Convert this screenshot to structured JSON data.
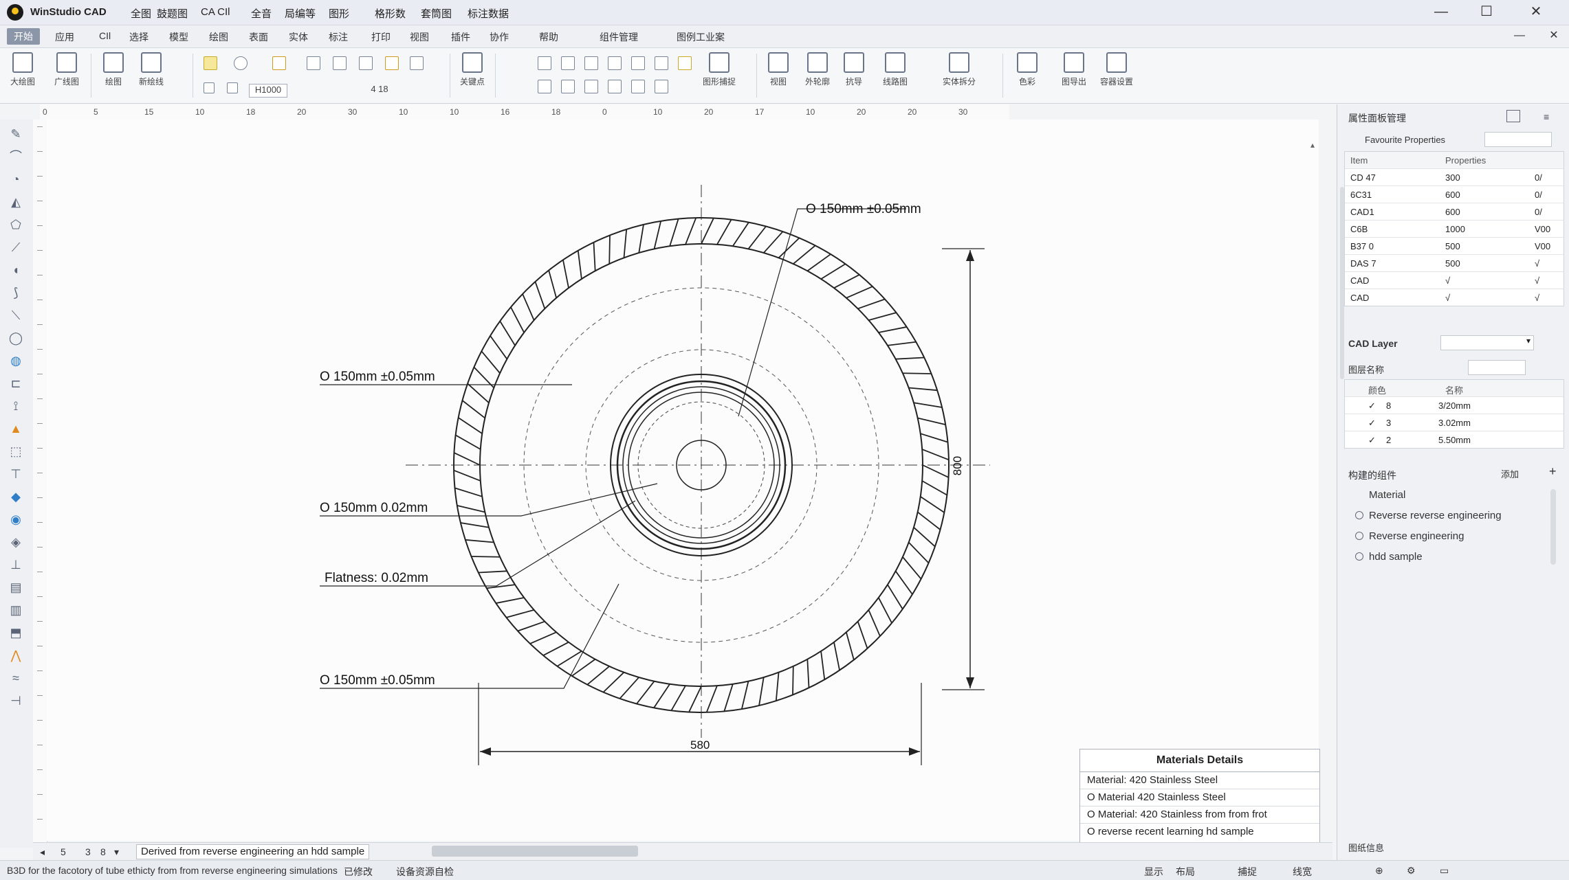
{
  "app": {
    "name": "WinStudio CAD",
    "menus": [
      "全图",
      "鼓题图",
      "CA CIl",
      "全音",
      "局编等",
      "图形",
      "格形数",
      "套筒图",
      "标注数据"
    ],
    "window_controls": [
      "—",
      "☐",
      "✕"
    ]
  },
  "tabs": [
    "开始",
    "应用",
    "CIl",
    "选择",
    "模型",
    "绘图",
    "表面",
    "实体",
    "标注",
    "打印",
    "视图",
    "插件",
    "协作",
    "帮助",
    "组件管理",
    "图例工业案"
  ],
  "ribbon": {
    "groups": [
      {
        "label": "大绘图"
      },
      {
        "label": "广线图"
      },
      {
        "label": "绘图"
      },
      {
        "label": "新绘线"
      },
      {
        "label": "H1000"
      },
      {
        "label": "4 18"
      },
      {
        "label": "关键点"
      },
      {
        "label": "图形捕捉"
      },
      {
        "label": "视图"
      },
      {
        "label": "外轮廓"
      },
      {
        "label": "抗导"
      },
      {
        "label": "线路图"
      },
      {
        "label": "实体拆分"
      },
      {
        "label": "色彩"
      },
      {
        "label": "图导出"
      },
      {
        "label": "容器设置"
      }
    ]
  },
  "ruler": {
    "ticks": [
      "0",
      "5",
      "15",
      "10",
      "18",
      "20",
      "30",
      "10",
      "10",
      "16",
      "18",
      "0",
      "10",
      "20",
      "17",
      "10",
      "20",
      "20",
      "30"
    ]
  },
  "drawing": {
    "annotations": [
      "Ο 150mm ±0.05mm",
      "Ο 150mm ±0.05mm",
      "Ο 150mm 0.02mm",
      "Flatness: 0.02mm",
      "Ο 150mm ±0.05mm"
    ],
    "dim_horizontal": "580",
    "dim_vertical": "800"
  },
  "materials": {
    "title": "Materials Details",
    "rows": [
      "Material: 420 Stainless Steel",
      "Ο Material  420 Stainless Steel",
      "Ο Material: 420 Stainless from from frot",
      "Ο reverse recent learning hd sample"
    ]
  },
  "canvas_tabs": [
    "5",
    "3",
    "8"
  ],
  "canvas_note": "Derived from reverse engineering an hdd sample",
  "status": {
    "left": "B3D  for the facotory of tube ethicty from from reverse engineering simulations",
    "mid1": "已修改",
    "mid2": "设备资源自检",
    "right": [
      "显示",
      "布局",
      "捕捉",
      "线宽"
    ]
  },
  "right_panel": {
    "properties_title": "属性面板管理",
    "filter_label": "Favourite Properties",
    "table_header": [
      "Item",
      "Properties"
    ],
    "rows": [
      {
        "name": "CD 47",
        "value": "300",
        "flag": "0/"
      },
      {
        "name": "6C31",
        "value": "600",
        "flag": "0/"
      },
      {
        "name": "CAD1",
        "value": "600",
        "flag": "0/"
      },
      {
        "name": "C6B",
        "value": "1000",
        "flag": "V00"
      },
      {
        "name": "B37 0",
        "value": "500",
        "flag": "V00"
      },
      {
        "name": "DAS 7",
        "value": "500",
        "flag": "√"
      },
      {
        "name": "CAD",
        "value": "√",
        "flag": "√"
      },
      {
        "name": "CAD",
        "value": "√",
        "flag": "√"
      }
    ],
    "layers_title": "CAD Layer",
    "layer_sub": "图层名称",
    "layer_header": [
      "颜色",
      "名称"
    ],
    "layers": [
      {
        "id": "8",
        "size": "3/20mm"
      },
      {
        "id": "3",
        "size": "3.02mm"
      },
      {
        "id": "2",
        "size": "5.50mm"
      }
    ],
    "tree_title": "构建的组件",
    "tree_button": "添加",
    "tree_items": [
      "Material",
      "Reverse reverse engineering",
      "Reverse engineering",
      "hdd sample"
    ],
    "bottom_label": "图纸信息"
  }
}
